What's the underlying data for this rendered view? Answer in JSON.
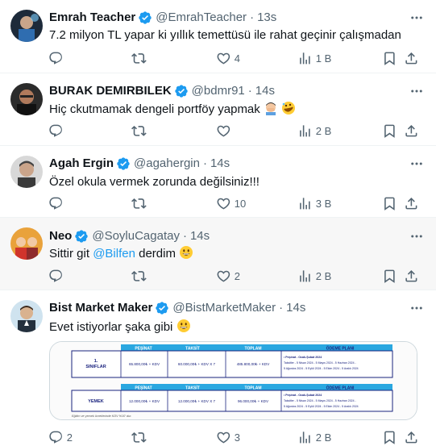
{
  "tweets": [
    {
      "name": "Emrah Teacher",
      "handle": "@EmrahTeacher",
      "time": "13s",
      "text": "7.2 milyon TL yapar ki yıllık temettüsü ile rahat geçinir çalışmadan",
      "reply_count": "",
      "retweet_count": "",
      "like_count": "4",
      "views": "1 B"
    },
    {
      "name": "BURAK DEMIRBILEK",
      "handle": "@bdmr91",
      "time": "14s",
      "text": "Hiç ckutmamak dengeli portföy yapmak",
      "emojis": [
        "man-facepalming-emoji",
        "rolling-laughing-emoji"
      ],
      "reply_count": "",
      "retweet_count": "",
      "like_count": "",
      "views": "2 B"
    },
    {
      "name": "Agah Ergin",
      "handle": "@agahergin",
      "time": "14s",
      "text": "Özel okula vermek zorunda değilsiniz!!!",
      "reply_count": "",
      "retweet_count": "",
      "like_count": "10",
      "views": "3 B"
    },
    {
      "name": "Neo",
      "handle": "@SoyluCagatay",
      "time": "14s",
      "text_before": "Sittir git ",
      "mention": "@Bilfen",
      "text_after": " derdim",
      "emojis": [
        "grinning-emoji"
      ],
      "reply_count": "",
      "retweet_count": "",
      "like_count": "2",
      "views": "2 B"
    },
    {
      "name": "Bist Market Maker",
      "handle": "@BistMarketMaker",
      "time": "14s",
      "text": "Evet istiyorlar şaka gibi",
      "emojis": [
        "grinning-emoji"
      ],
      "reply_count": "2",
      "retweet_count": "",
      "like_count": "3",
      "views": "2 B"
    }
  ],
  "media": {
    "table1_headers": [
      "PEŞİNAT",
      "TAKSİT",
      "TOPLAM",
      "ÖDEME PLANI"
    ],
    "row1_label_a": "1.",
    "row1_label_b": "SINIFLAR",
    "row1_pesinat": "65.800,00₺ + KDV",
    "row1_taksit": "60.000,00₺ + KDV X 7",
    "row1_toplam": "485.800,00₺ + KDV",
    "plan_line1": "• Peşinat - Ocak-Şubat 2024",
    "plan_line2": "Taksitler - 5 Nisan 2024 - 5 Mayıs 2024 - 5 Haziran 2024 -",
    "plan_line3": "5 Ağustos 2024 - 5 Eylül 2024 - 5 Ekim 2024 - 5 Aralık 2024",
    "table2_headers": [
      "PEŞİNAT",
      "TAKSİT",
      "TOPLAM",
      "ÖDEME PLANI"
    ],
    "row2_label": "YEMEK",
    "row2_pesinat": "12.000,00₺ + KDV",
    "row2_taksit": "12.000,00₺ + KDV X 7",
    "row2_toplam": "96.000,00₺ + KDV",
    "plan2_line1": "• Peşinat - Ocak-Şubat 2024",
    "plan2_line2": "Taksitler - 5 Nisan 2024 - 5 Mayıs 2024 - 5 Haziran 2024 -",
    "plan2_line3": "5 Ağustos 2024 - 5 Eylül 2024 - 5 Ekim 2024 - 5 Aralık 2024",
    "footnote": "Eğitim ve yemek ücretlerinde KDV %10' dur."
  },
  "colors": {
    "verified": "#1d9bf0",
    "text_secondary": "#536471",
    "divider": "#eff3f4",
    "table_header": "#2aa7e0",
    "table_border": "#1a237e"
  }
}
